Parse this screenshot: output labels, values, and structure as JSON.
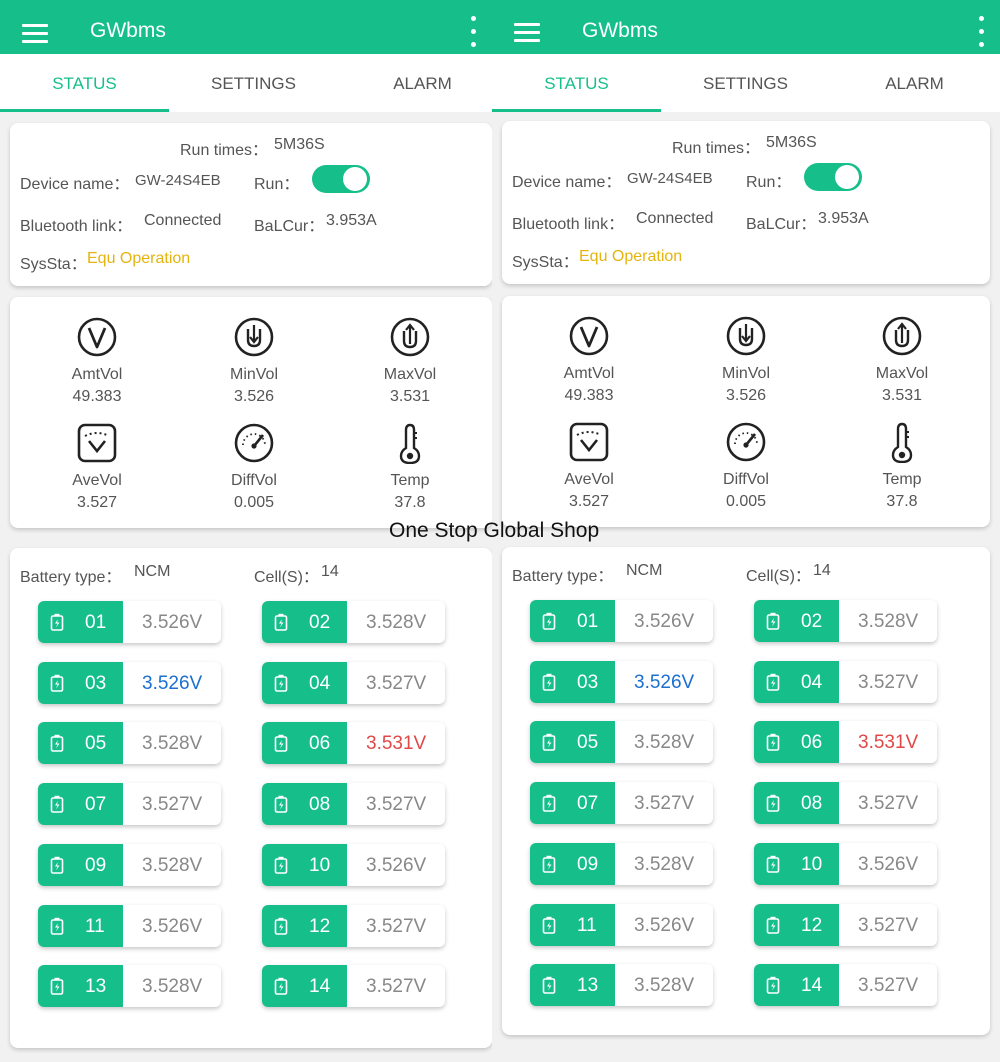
{
  "app": {
    "title": "GWbms"
  },
  "tabs": [
    "STATUS",
    "SETTINGS",
    "ALARM"
  ],
  "info": {
    "run_times_label": "Run times：",
    "run_times": "5M36S",
    "device_name_label": "Device name：",
    "device_name": "GW-24S4EB",
    "run_label": "Run：",
    "run_on": true,
    "bluetooth_label": "Bluetooth link：",
    "bluetooth": "Connected",
    "balcur_label": "BaLCur：",
    "balcur": "3.953A",
    "syssta_label": "SysSta：",
    "syssta": "Equ Operation"
  },
  "metrics": [
    {
      "label": "AmtVol",
      "value": "49.383",
      "icon": "voltage-v-icon"
    },
    {
      "label": "MinVol",
      "value": "3.526",
      "icon": "min-voltage-down-icon"
    },
    {
      "label": "MaxVol",
      "value": "3.531",
      "icon": "max-voltage-up-icon"
    },
    {
      "label": "AveVol",
      "value": "3.527",
      "icon": "average-voltage-icon"
    },
    {
      "label": "DiffVol",
      "value": "0.005",
      "icon": "gauge-icon"
    },
    {
      "label": "Temp",
      "value": "37.8",
      "icon": "thermometer-icon"
    }
  ],
  "battery": {
    "type_label": "Battery type：",
    "type": "NCM",
    "cells_label": "Cell(S)：",
    "cells": "14"
  },
  "cells": [
    {
      "id": "01",
      "voltage": "3.526V",
      "state": "normal"
    },
    {
      "id": "02",
      "voltage": "3.528V",
      "state": "normal"
    },
    {
      "id": "03",
      "voltage": "3.526V",
      "state": "min"
    },
    {
      "id": "04",
      "voltage": "3.527V",
      "state": "normal"
    },
    {
      "id": "05",
      "voltage": "3.528V",
      "state": "normal"
    },
    {
      "id": "06",
      "voltage": "3.531V",
      "state": "max"
    },
    {
      "id": "07",
      "voltage": "3.527V",
      "state": "normal"
    },
    {
      "id": "08",
      "voltage": "3.527V",
      "state": "normal"
    },
    {
      "id": "09",
      "voltage": "3.528V",
      "state": "normal"
    },
    {
      "id": "10",
      "voltage": "3.526V",
      "state": "normal"
    },
    {
      "id": "11",
      "voltage": "3.526V",
      "state": "normal"
    },
    {
      "id": "12",
      "voltage": "3.527V",
      "state": "normal"
    },
    {
      "id": "13",
      "voltage": "3.528V",
      "state": "normal"
    },
    {
      "id": "14",
      "voltage": "3.527V",
      "state": "normal"
    }
  ],
  "colors": {
    "accent": "#16bf8a",
    "warning": "#e4b40e",
    "min": "#1a6fd1",
    "max": "#e04848"
  },
  "watermark": "One Stop Global Shop"
}
